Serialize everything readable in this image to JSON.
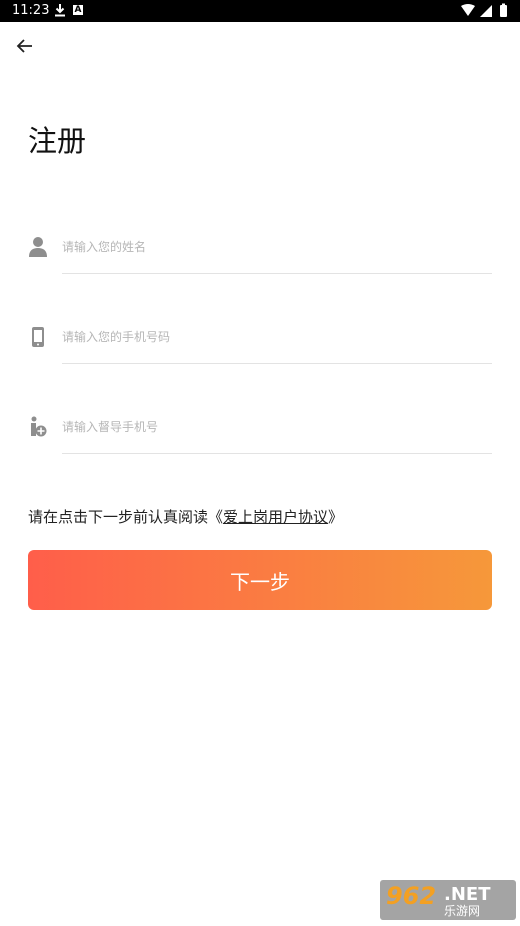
{
  "status_bar": {
    "time": "11:23",
    "badge_letter": "A"
  },
  "header": {
    "title": "注册"
  },
  "form": {
    "fields": [
      {
        "icon": "person-icon",
        "placeholder": "请输入您的姓名",
        "value": ""
      },
      {
        "icon": "phone-icon",
        "placeholder": "请输入您的手机号码",
        "value": ""
      },
      {
        "icon": "mentor-icon",
        "placeholder": "请输入督导手机号",
        "value": ""
      }
    ]
  },
  "agreement": {
    "prefix": "请在点击下一步前认真阅读《",
    "link_text": "爱上岗用户协议",
    "suffix": "》"
  },
  "next_button": {
    "label": "下一步"
  },
  "watermark": {
    "number": "962",
    "domain": ".NET",
    "site_name": "乐游网"
  },
  "colors": {
    "gradient_start": "#ff5e4a",
    "gradient_end": "#f6983a",
    "icon_gray": "#8e8e8e"
  }
}
